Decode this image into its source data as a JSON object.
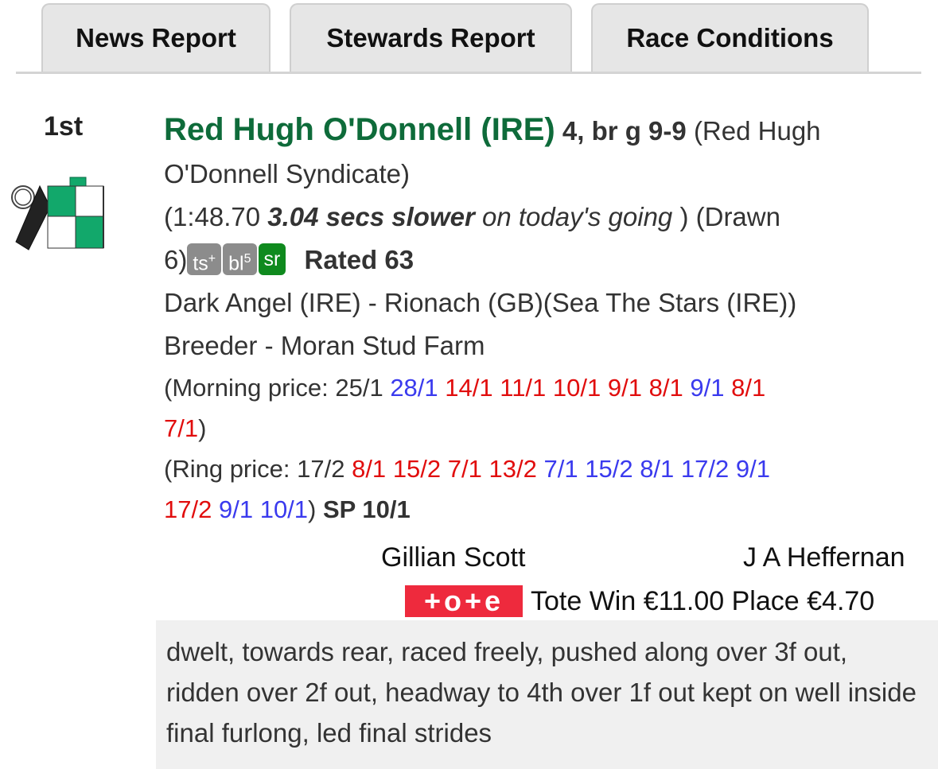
{
  "tabs": [
    "News Report",
    "Stewards Report",
    "Race Conditions"
  ],
  "position": "1st",
  "horse": {
    "name": "Red Hugh O'Donnell (IRE)",
    "details": "4, br g 9-9",
    "owner_part1": "(Red Hugh",
    "owner_part2": "O'Donnell Syndicate)"
  },
  "time": {
    "open": "(1:48.70",
    "secs": "3.04 secs slower",
    "going": "on today's going",
    "close": ") (Drawn",
    "drawn_num": "6)"
  },
  "badges": [
    {
      "text": "ts",
      "sup": "+"
    },
    {
      "text": "bl",
      "sup": "5"
    },
    {
      "text": "sr",
      "sup": ""
    }
  ],
  "rating": "Rated 63",
  "breeding": "Dark Angel (IRE) - Rionach (GB)(Sea The Stars (IRE))",
  "breeder": "Breeder - Moran Stud Farm",
  "morning_price": {
    "label": "(Morning price: 25/1",
    "line1": [
      {
        "text": "28/1",
        "color": "blue"
      },
      {
        "text": "14/1",
        "color": "red"
      },
      {
        "text": "11/1",
        "color": "red"
      },
      {
        "text": "10/1",
        "color": "red"
      },
      {
        "text": "9/1",
        "color": "red"
      },
      {
        "text": "8/1",
        "color": "red"
      },
      {
        "text": "9/1",
        "color": "blue"
      },
      {
        "text": "8/1",
        "color": "red"
      }
    ],
    "line2": [
      {
        "text": "7/1",
        "color": "red"
      }
    ],
    "close": ")"
  },
  "ring_price": {
    "label": "(Ring price: 17/2",
    "line1": [
      {
        "text": "8/1",
        "color": "red"
      },
      {
        "text": "15/2",
        "color": "red"
      },
      {
        "text": "7/1",
        "color": "red"
      },
      {
        "text": "13/2",
        "color": "red"
      },
      {
        "text": "7/1",
        "color": "blue"
      },
      {
        "text": "15/2",
        "color": "blue"
      },
      {
        "text": "8/1",
        "color": "blue"
      },
      {
        "text": "17/2",
        "color": "blue"
      },
      {
        "text": "9/1",
        "color": "blue"
      }
    ],
    "line2": [
      {
        "text": "17/2",
        "color": "red"
      },
      {
        "text": "9/1",
        "color": "blue"
      },
      {
        "text": "10/1",
        "color": "blue"
      }
    ],
    "close": ")",
    "sp": "SP 10/1"
  },
  "trainer": "Gillian Scott",
  "jockey": "J A Heffernan",
  "tote": {
    "logo": "+o+e",
    "text": "Tote Win €11.00 Place €4.70"
  },
  "comment": "dwelt, towards rear, raced freely, pushed along over 3f out, ridden over 2f out, headway to 4th over 1f out kept on well inside final furlong, led final strides",
  "colors": {
    "horse_name": "#0e6b3a",
    "price_drift": "#3a3aee",
    "price_shorten": "#e10d0d",
    "badge_grey": "#8c8c8c",
    "badge_green": "#0f8a1e",
    "tote_brand": "#ee2a3d"
  }
}
